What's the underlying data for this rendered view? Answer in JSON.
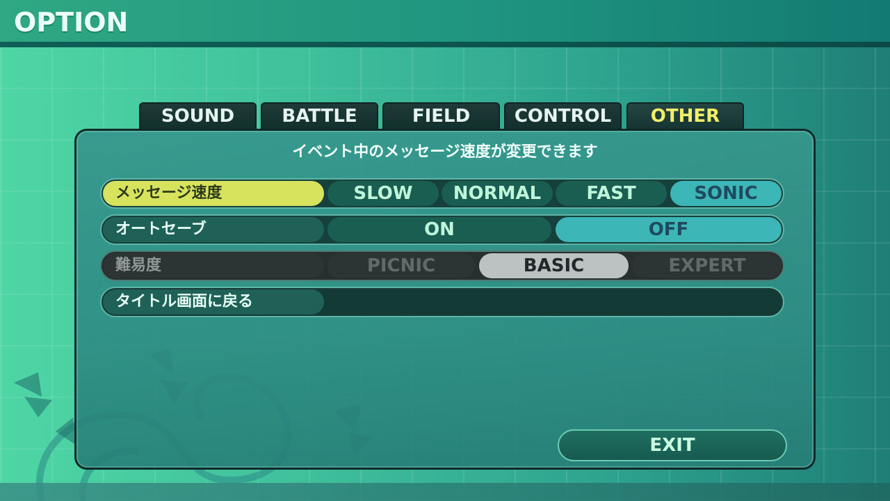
{
  "header": {
    "title": "OPTION"
  },
  "tabs": [
    {
      "label": "SOUND"
    },
    {
      "label": "BATTLE"
    },
    {
      "label": "FIELD"
    },
    {
      "label": "CONTROL"
    },
    {
      "label": "OTHER",
      "active": true
    }
  ],
  "description": "イベント中のメッセージ速度が変更できます",
  "settings": {
    "message_speed": {
      "label": "メッセージ速度",
      "options": [
        "SLOW",
        "NORMAL",
        "FAST",
        "SONIC"
      ],
      "selected": "SONIC"
    },
    "autosave": {
      "label": "オートセーブ",
      "options": [
        "ON",
        "OFF"
      ],
      "selected": "OFF"
    },
    "difficulty": {
      "label": "難易度",
      "options": [
        "PICNIC",
        "BASIC",
        "EXPERT"
      ],
      "selected": "BASIC",
      "disabled": true
    },
    "return_title": {
      "label": "タイトル画面に戻る"
    }
  },
  "exit": {
    "label": "EXIT"
  },
  "colors": {
    "highlight_label": "#d7e35d",
    "selected_option": "#3cb6b6",
    "active_tab_text": "#f3ee6a",
    "panel": "#2e8c84"
  }
}
